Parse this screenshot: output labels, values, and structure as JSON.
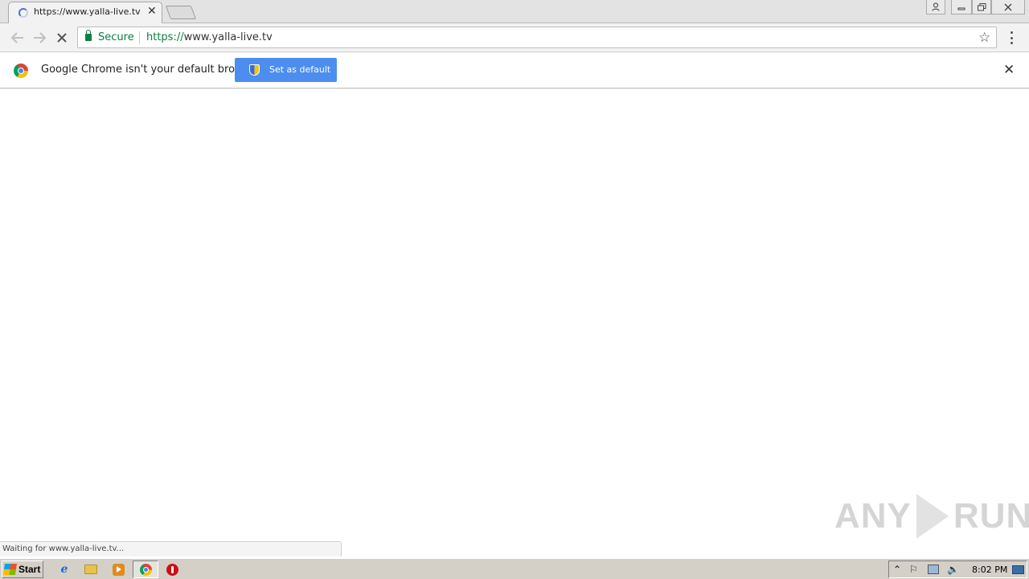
{
  "browser": {
    "tab_title": "https://www.yalla-live.tv",
    "tab_close_glyph": "✕",
    "address": {
      "secure_label": "Secure",
      "url_scheme": "https://",
      "url_host": "www.yalla-live.tv"
    },
    "icons": [
      "back-arrow-icon",
      "forward-arrow-icon",
      "stop-icon",
      "lock-icon",
      "star-icon",
      "menu-dots-icon",
      "user-icon",
      "minimize-icon",
      "restore-icon",
      "close-icon"
    ]
  },
  "infobar": {
    "message": "Google Chrome isn't your default browser",
    "button_label": "Set as default",
    "close_glyph": "✕"
  },
  "status_bar": {
    "text": "Waiting for www.yalla-live.tv..."
  },
  "watermark": {
    "left_text": "ANY",
    "right_text": "RUN"
  },
  "taskbar": {
    "start_label": "Start",
    "clock": "8:02 PM",
    "apps": [
      "internet-explorer-icon",
      "file-explorer-icon",
      "media-player-icon",
      "chrome-icon",
      "opera-icon"
    ]
  },
  "colors": {
    "secure_green": "#0b8043",
    "button_blue": "#4c8ef0",
    "taskbar_gray": "#d4d0c8"
  }
}
